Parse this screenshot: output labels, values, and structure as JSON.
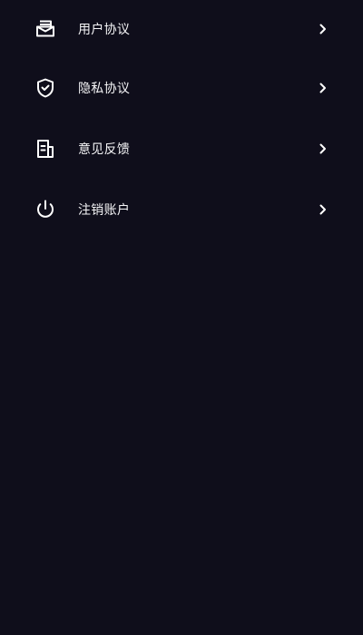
{
  "theme": {
    "background": "#0f0e1b",
    "icon_color": "#ffffff",
    "text_color": "#f5f5f7"
  },
  "menu": {
    "items": [
      {
        "label": "用户协议",
        "icon": "envelope-icon"
      },
      {
        "label": "隐私协议",
        "icon": "shield-check-icon"
      },
      {
        "label": "意见反馈",
        "icon": "document-icon"
      },
      {
        "label": "注销账户",
        "icon": "power-icon"
      }
    ]
  }
}
